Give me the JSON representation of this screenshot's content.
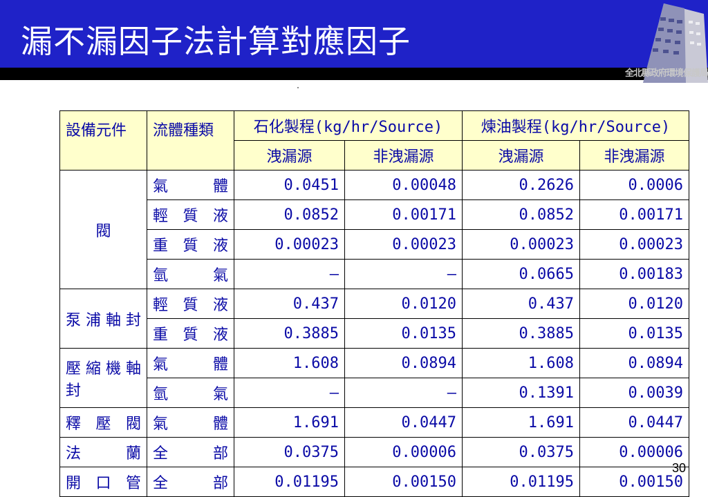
{
  "title": "漏不漏因子法計算對應因子",
  "logo_caption": "全北縣政府環境保護局",
  "page_number": "30",
  "table": {
    "headers": {
      "col1": "設備元件",
      "col2": "流體種類",
      "group_petrochem": "石化製程(kg/hr/Source)",
      "group_refining": "煉油製程(kg/hr/Source)",
      "leak": "洩漏源",
      "nonleak": "非洩漏源"
    },
    "groups": [
      {
        "equipment": "閥",
        "rows": [
          {
            "fluid": "氣　　體",
            "v": [
              "0.0451",
              "0.00048",
              "0.2626",
              "0.0006"
            ]
          },
          {
            "fluid": "輕質液",
            "v": [
              "0.0852",
              "0.00171",
              "0.0852",
              "0.00171"
            ]
          },
          {
            "fluid": "重質液",
            "v": [
              "0.00023",
              "0.00023",
              "0.00023",
              "0.00023"
            ]
          },
          {
            "fluid": "氫　　氣",
            "v": [
              "—",
              "—",
              "0.0665",
              "0.00183"
            ]
          }
        ]
      },
      {
        "equipment": "泵浦軸封",
        "rows": [
          {
            "fluid": "輕質液",
            "v": [
              "0.437",
              "0.0120",
              "0.437",
              "0.0120"
            ]
          },
          {
            "fluid": "重質液",
            "v": [
              "0.3885",
              "0.0135",
              "0.3885",
              "0.0135"
            ]
          }
        ]
      },
      {
        "equipment": "壓縮機軸封",
        "rows": [
          {
            "fluid": "氣　　體",
            "v": [
              "1.608",
              "0.0894",
              "1.608",
              "0.0894"
            ]
          },
          {
            "fluid": "氫　　氣",
            "v": [
              "—",
              "—",
              "0.1391",
              "0.0039"
            ]
          }
        ]
      },
      {
        "equipment": "釋壓閥",
        "rows": [
          {
            "fluid": "氣　　體",
            "v": [
              "1.691",
              "0.0447",
              "1.691",
              "0.0447"
            ]
          }
        ]
      },
      {
        "equipment": "法蘭",
        "rows": [
          {
            "fluid": "全部",
            "v": [
              "0.0375",
              "0.00006",
              "0.0375",
              "0.00006"
            ]
          }
        ]
      },
      {
        "equipment": "開口管",
        "rows": [
          {
            "fluid": "全部",
            "v": [
              "0.01195",
              "0.00150",
              "0.01195",
              "0.00150"
            ]
          }
        ]
      }
    ]
  }
}
